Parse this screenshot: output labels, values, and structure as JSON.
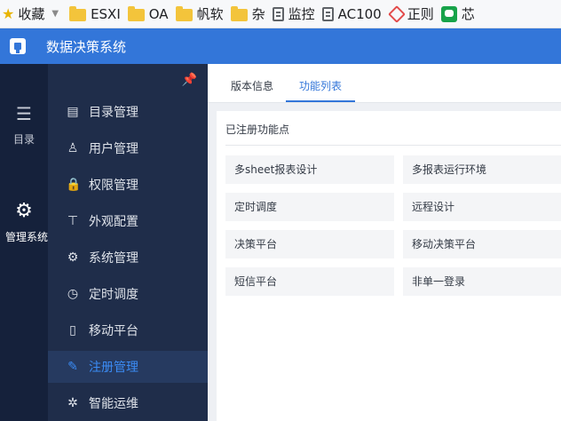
{
  "bookmarks": {
    "favorites": "收藏",
    "items": [
      {
        "label": "ESXI",
        "icon": "folder-icon"
      },
      {
        "label": "OA",
        "icon": "folder-icon"
      },
      {
        "label": "帆软",
        "icon": "folder-icon"
      },
      {
        "label": "杂",
        "icon": "folder-icon"
      },
      {
        "label": "监控",
        "icon": "page-icon"
      },
      {
        "label": "AC100",
        "icon": "page-icon"
      },
      {
        "label": "正则",
        "icon": "regex-icon"
      },
      {
        "label": "芯",
        "icon": "green-app-icon"
      }
    ]
  },
  "header": {
    "title": "数据决策系统",
    "accent": "#3376d9"
  },
  "rail": {
    "items": [
      {
        "label": "目录",
        "icon": "list-icon"
      },
      {
        "label": "管理系统",
        "icon": "gear-icon"
      }
    ]
  },
  "menu": {
    "items": [
      {
        "label": "目录管理",
        "icon": "catalog-icon"
      },
      {
        "label": "用户管理",
        "icon": "user-icon"
      },
      {
        "label": "权限管理",
        "icon": "lock-icon"
      },
      {
        "label": "外观配置",
        "icon": "paint-roller-icon"
      },
      {
        "label": "系统管理",
        "icon": "settings-icon"
      },
      {
        "label": "定时调度",
        "icon": "timer-icon"
      },
      {
        "label": "移动平台",
        "icon": "mobile-icon"
      },
      {
        "label": "注册管理",
        "icon": "register-icon"
      },
      {
        "label": "智能运维",
        "icon": "network-icon"
      }
    ],
    "active": "注册管理"
  },
  "tabs": [
    {
      "label": "版本信息"
    },
    {
      "label": "功能列表"
    }
  ],
  "panel": {
    "title": "已注册功能点",
    "features": [
      "多sheet报表设计",
      "多报表运行环境",
      "定时调度",
      "远程设计",
      "决策平台",
      "移动决策平台",
      "短信平台",
      "非单一登录"
    ]
  }
}
